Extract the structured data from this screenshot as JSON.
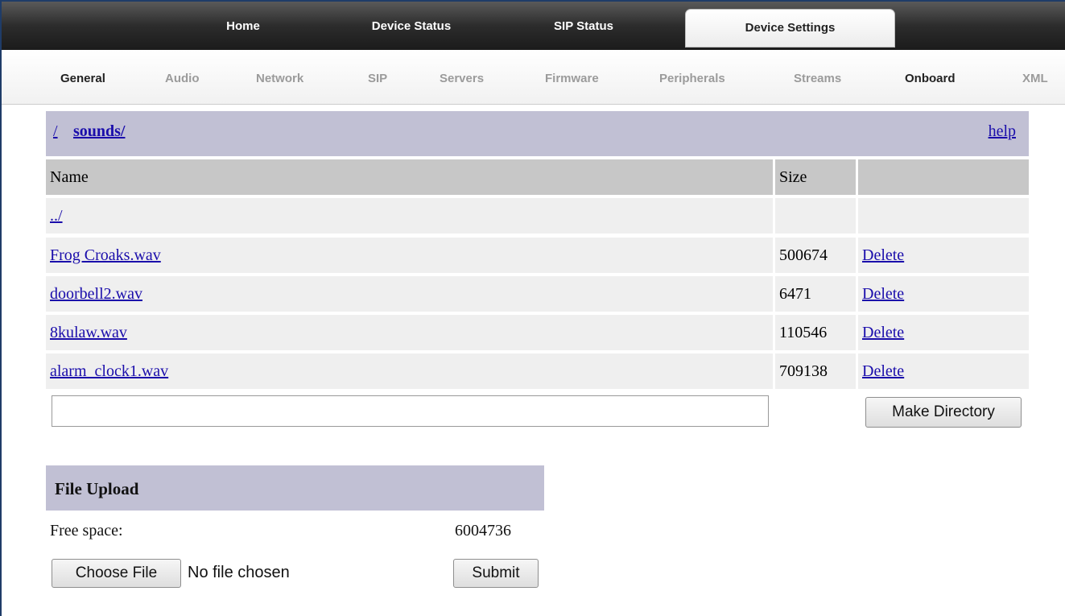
{
  "top_nav": {
    "tabs": [
      {
        "label": "Home"
      },
      {
        "label": "Device Status"
      },
      {
        "label": "SIP Status"
      },
      {
        "label": "Device Settings",
        "active": true
      }
    ]
  },
  "sub_nav": {
    "items": [
      {
        "label": "General",
        "active": true
      },
      {
        "label": "Audio"
      },
      {
        "label": "Network"
      },
      {
        "label": "SIP"
      },
      {
        "label": "Servers"
      },
      {
        "label": "Firmware"
      },
      {
        "label": "Peripherals"
      },
      {
        "label": "Streams"
      },
      {
        "label": "Onboard",
        "active": true
      },
      {
        "label": "XML"
      }
    ]
  },
  "browser": {
    "path_root": "/",
    "path_dir": "sounds/",
    "help_label": "help",
    "columns": {
      "name": "Name",
      "size": "Size"
    },
    "parent_link": "../",
    "files": [
      {
        "name": "Frog Croaks.wav",
        "size": "500674",
        "action": "Delete"
      },
      {
        "name": "doorbell2.wav",
        "size": "6471",
        "action": "Delete"
      },
      {
        "name": "8kulaw.wav",
        "size": "110546",
        "action": "Delete"
      },
      {
        "name": "alarm_clock1.wav",
        "size": "709138",
        "action": "Delete"
      }
    ],
    "new_directory_value": "",
    "make_directory_label": "Make Directory"
  },
  "upload": {
    "title": "File Upload",
    "free_space_label": "Free space:",
    "free_space_value": "6004736",
    "choose_file_label": "Choose File",
    "no_file_text": "No file chosen",
    "submit_label": "Submit"
  },
  "colors": {
    "header_band": "#c1c0d4",
    "link": "#1a0dab",
    "row_bg": "#efefef",
    "column_header_bg": "#c7c7c7"
  }
}
